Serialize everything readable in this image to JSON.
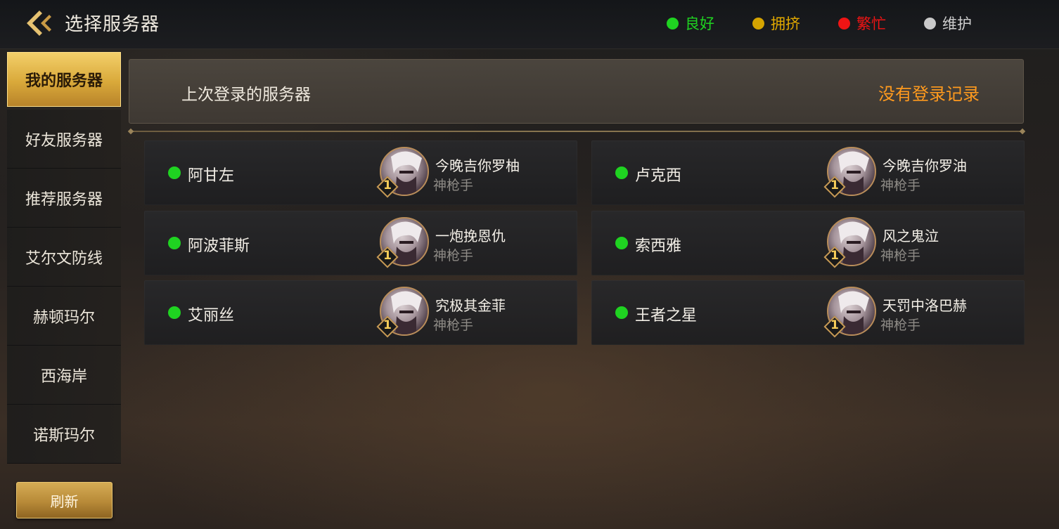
{
  "header": {
    "title": "选择服务器",
    "legend": [
      {
        "label": "良好",
        "color": "#1fd321"
      },
      {
        "label": "拥挤",
        "color": "#d5a400"
      },
      {
        "label": "繁忙",
        "color": "#f01414"
      },
      {
        "label": "维护",
        "color": "#c9c9c9"
      }
    ]
  },
  "sidebar": {
    "items": [
      {
        "label": "我的服务器",
        "active": true
      },
      {
        "label": "好友服务器",
        "active": false
      },
      {
        "label": "推荐服务器",
        "active": false
      },
      {
        "label": "艾尔文防线",
        "active": false
      },
      {
        "label": "赫顿玛尔",
        "active": false
      },
      {
        "label": "西海岸",
        "active": false
      },
      {
        "label": "诺斯玛尔",
        "active": false
      }
    ],
    "refresh_label": "刷新"
  },
  "last_login": {
    "label": "上次登录的服务器",
    "value": "没有登录记录",
    "value_color": "#ff9a1e"
  },
  "servers": [
    {
      "name": "阿甘左",
      "status_color": "#1fd321",
      "character": "今晚吉你罗柚",
      "class": "神枪手",
      "level": "1"
    },
    {
      "name": "卢克西",
      "status_color": "#1fd321",
      "character": "今晚吉你罗油",
      "class": "神枪手",
      "level": "1"
    },
    {
      "name": "阿波菲斯",
      "status_color": "#1fd321",
      "character": "一炮挽恩仇",
      "class": "神枪手",
      "level": "1"
    },
    {
      "name": "索西雅",
      "status_color": "#1fd321",
      "character": "风之鬼泣",
      "class": "神枪手",
      "level": "1"
    },
    {
      "name": "艾丽丝",
      "status_color": "#1fd321",
      "character": "究极其金菲",
      "class": "神枪手",
      "level": "1"
    },
    {
      "name": "王者之星",
      "status_color": "#1fd321",
      "character": "天罚中洛巴赫",
      "class": "神枪手",
      "level": "1"
    }
  ]
}
